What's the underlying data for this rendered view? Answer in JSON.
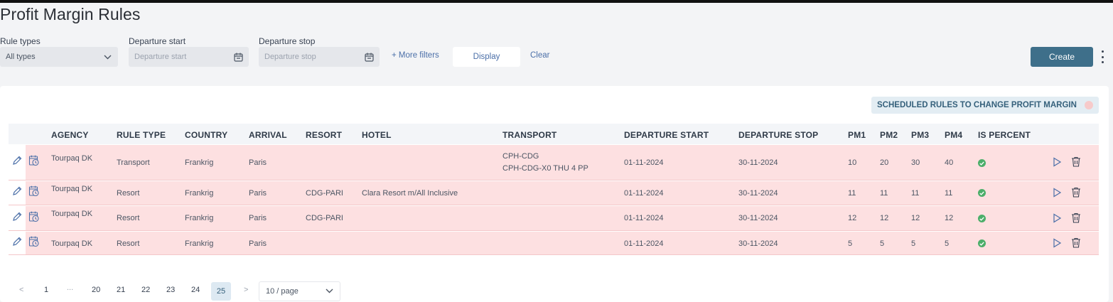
{
  "page": {
    "title": "Profit Margin Rules"
  },
  "filters": {
    "rule_types": {
      "label": "Rule types",
      "value": "All types"
    },
    "departure_start": {
      "label": "Departure start",
      "placeholder": "Departure start"
    },
    "departure_stop": {
      "label": "Departure stop",
      "placeholder": "Departure stop"
    },
    "more_filters": "+ More filters",
    "display": "Display",
    "clear": "Clear"
  },
  "toolbar": {
    "create": "Create"
  },
  "badge": {
    "scheduled": "SCHEDULED RULES TO CHANGE PROFIT MARGIN"
  },
  "table": {
    "columns": [
      "AGENCY",
      "RULE TYPE",
      "COUNTRY",
      "ARRIVAL",
      "RESORT",
      "HOTEL",
      "TRANSPORT",
      "DEPARTURE START",
      "DEPARTURE STOP",
      "PM1",
      "PM2",
      "PM3",
      "PM4",
      "IS PERCENT"
    ],
    "rows": [
      {
        "agency": "Tourpaq DK",
        "rule_type": "Transport",
        "country": "Frankrig",
        "arrival": "Paris",
        "resort": "",
        "hotel": "",
        "transport": "CPH-CDG",
        "transport2": "CPH-CDG-X0 THU 4 PP",
        "dep_start": "01-11-2024",
        "dep_stop": "30-11-2024",
        "pm1": "10",
        "pm2": "20",
        "pm3": "30",
        "pm4": "40",
        "is_percent": true
      },
      {
        "agency": "Tourpaq DK",
        "rule_type": "Resort",
        "country": "Frankrig",
        "arrival": "Paris",
        "resort": "CDG-PARI",
        "hotel": "Clara Resort m/All Inclusive",
        "transport": "",
        "transport2": "",
        "dep_start": "01-11-2024",
        "dep_stop": "30-11-2024",
        "pm1": "11",
        "pm2": "11",
        "pm3": "11",
        "pm4": "11",
        "is_percent": true
      },
      {
        "agency": "Tourpaq DK",
        "rule_type": "Resort",
        "country": "Frankrig",
        "arrival": "Paris",
        "resort": "CDG-PARI",
        "hotel": "",
        "transport": "",
        "transport2": "",
        "dep_start": "01-11-2024",
        "dep_stop": "30-11-2024",
        "pm1": "12",
        "pm2": "12",
        "pm3": "12",
        "pm4": "12",
        "is_percent": true
      },
      {
        "agency": "Tourpaq DK",
        "rule_type": "Resort",
        "country": "Frankrig",
        "arrival": "Paris",
        "resort": "",
        "hotel": "",
        "transport": "",
        "transport2": "",
        "dep_start": "01-11-2024",
        "dep_stop": "30-11-2024",
        "pm1": "5",
        "pm2": "5",
        "pm3": "5",
        "pm4": "5",
        "is_percent": true
      }
    ]
  },
  "pagination": {
    "prev": "<",
    "pages": [
      "1",
      "...",
      "20",
      "21",
      "22",
      "23",
      "24",
      "25"
    ],
    "current": "25",
    "next": ">",
    "page_size": "10 / page"
  },
  "icons": {
    "edit": "pencil-icon",
    "schedule": "calendar-clock-icon",
    "run": "play-icon",
    "delete": "trash-icon",
    "is_percent": "check-circle-icon",
    "date": "calendar-icon",
    "select": "chevron-down-icon"
  },
  "colors": {
    "primary": "#3e6f8a",
    "row_highlight": "#fde0e1",
    "success": "#4cae6a",
    "link": "#4b6fa8"
  }
}
